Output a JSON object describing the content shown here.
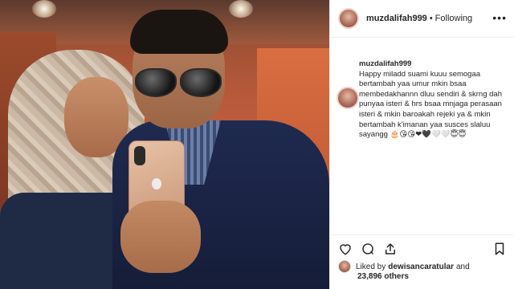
{
  "post": {
    "username": "muzdalifah999",
    "follow_status": "Following",
    "separator": "•",
    "more": "•••",
    "caption_user": "muzdalifah999",
    "caption": "Happy miladd suami kuuu semogaa bertambah yaa umur mkin bsaa membedakhannn dluu sendiri & skrng dah punyaa isteri & hrs bsaa mnjaga perasaan isteri & mkin baroakah rejeki ya & mkin bertambah k'imanan yaa susces slaluu sayangg 🎂😘😘❤🖤🤍🤍😇😇",
    "liked_prefix": "Liked by",
    "liked_user": "dewisancaratular",
    "liked_and": "and",
    "likes_count": "23,896 others"
  },
  "icons": {
    "heart": "heart-icon",
    "comment": "comment-icon",
    "share": "share-icon",
    "save": "bookmark-icon"
  },
  "colors": {
    "text": "#262626",
    "border": "#efefef"
  }
}
